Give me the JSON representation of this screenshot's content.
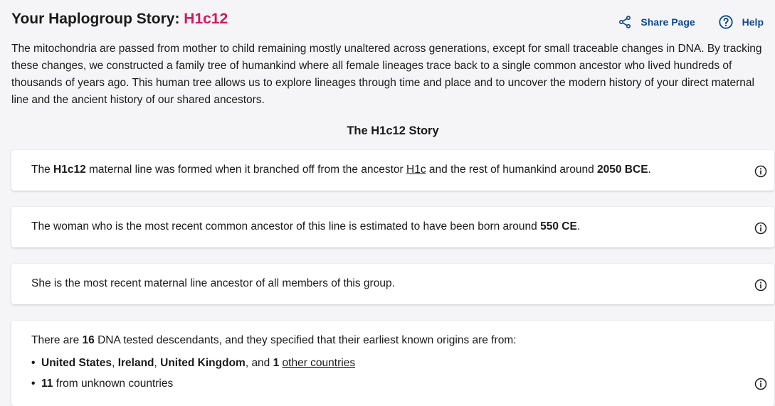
{
  "header": {
    "title_prefix": "Your Haplogroup Story:",
    "haplogroup": "H1c12",
    "share_label": "Share Page",
    "help_label": "Help"
  },
  "intro": "The mitochondria are passed from mother to child remaining mostly unaltered across generations, except for small traceable changes in DNA. By tracking these changes, we constructed a family tree of humankind where all female lineages trace back to a single common ancestor who lived hundreds of thousands of years ago. This human tree allows us to explore lineages through time and place and to uncover the modern history of your direct maternal line and the ancient history of our shared ancestors.",
  "story_title": "The H1c12 Story",
  "cards": {
    "formed": {
      "t1": "The ",
      "haplogroup": "H1c12",
      "t2": " maternal line was formed when it branched off from the ancestor ",
      "parent_link": "H1c",
      "t3": " and the rest of humankind around ",
      "date": "2050 BCE",
      "t4": "."
    },
    "mrca": {
      "t1": "The woman who is the most recent common ancestor of this line is estimated to have been born around ",
      "date": "550 CE",
      "t2": "."
    },
    "ancestor": {
      "text": "She is the most recent maternal line ancestor of all members of this group."
    },
    "descendants": {
      "t1": "There are ",
      "count": "16",
      "t2": " DNA tested descendants, and they specified that their earliest known origins are from:",
      "bullet1": {
        "c1": "United States",
        "sep1": ", ",
        "c2": "Ireland",
        "sep2": ", ",
        "c3": "United Kingdom",
        "sep3": ", and ",
        "other_count": "1",
        "space": " ",
        "other_link": "other countries"
      },
      "bullet2": {
        "count": "11",
        "text": " from unknown countries"
      }
    }
  },
  "colors": {
    "accent": "#d0185e",
    "link_blue": "#0b4a8c",
    "background": "#f5f5f7"
  },
  "icons": [
    "share-icon",
    "help-icon",
    "info-icon"
  ]
}
